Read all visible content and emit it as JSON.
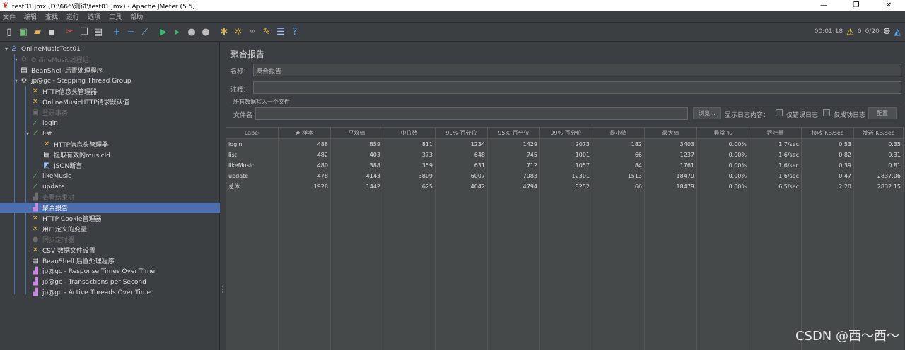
{
  "window": {
    "title": "test01.jmx (D:\\666\\测试\\test01.jmx) - Apache JMeter (5.5)",
    "minimize": "—",
    "maximize": "❐",
    "close": "✕"
  },
  "menu": [
    "文件",
    "编辑",
    "查找",
    "运行",
    "选项",
    "工具",
    "帮助"
  ],
  "status": {
    "elapsed": "00:01:18",
    "warnings": "0",
    "threads": "0/20"
  },
  "tree": [
    {
      "label": "OnlineMusicTest01",
      "icon": "test-plan-icon",
      "level": 0,
      "twisty": "▾",
      "disabled": false
    },
    {
      "label": "OnlineMusic线程组",
      "icon": "gear-icon",
      "level": 1,
      "twisty": "›",
      "disabled": true
    },
    {
      "label": "BeanShell 后置处理程序",
      "icon": "script-icon",
      "level": 1,
      "twisty": "",
      "disabled": false
    },
    {
      "label": "jp@gc - Stepping Thread Group",
      "icon": "gear-icon",
      "level": 1,
      "twisty": "▾",
      "disabled": false
    },
    {
      "label": "HTTP信息头管理器",
      "icon": "wrench-icon",
      "level": 2,
      "twisty": "",
      "disabled": false
    },
    {
      "label": "OnlineMusicHTTP请求默认值",
      "icon": "wrench-icon",
      "level": 2,
      "twisty": "",
      "disabled": false
    },
    {
      "label": "登录事务",
      "icon": "transaction-icon",
      "level": 2,
      "twisty": "",
      "disabled": true
    },
    {
      "label": "login",
      "icon": "pipette-icon",
      "level": 2,
      "twisty": "",
      "disabled": false
    },
    {
      "label": "list",
      "icon": "pipette-icon",
      "level": 2,
      "twisty": "▾",
      "disabled": false
    },
    {
      "label": "HTTP信息头管理器",
      "icon": "wrench-icon",
      "level": 3,
      "twisty": "",
      "disabled": false
    },
    {
      "label": "提取有效的musicId",
      "icon": "script-icon",
      "level": 3,
      "twisty": "",
      "disabled": false
    },
    {
      "label": "JSON断言",
      "icon": "assertion-icon",
      "level": 3,
      "twisty": "",
      "disabled": false
    },
    {
      "label": "likeMusic",
      "icon": "pipette-icon",
      "level": 2,
      "twisty": "",
      "disabled": false
    },
    {
      "label": "update",
      "icon": "pipette-icon",
      "level": 2,
      "twisty": "",
      "disabled": false
    },
    {
      "label": "查看结果树",
      "icon": "chart-icon",
      "level": 2,
      "twisty": "",
      "disabled": true
    },
    {
      "label": "聚合报告",
      "icon": "chart-icon",
      "level": 2,
      "twisty": "",
      "disabled": false,
      "selected": true
    },
    {
      "label": "HTTP Cookie管理器",
      "icon": "wrench-icon",
      "level": 2,
      "twisty": "",
      "disabled": false
    },
    {
      "label": "用户定义的变量",
      "icon": "wrench-icon",
      "level": 2,
      "twisty": "",
      "disabled": false
    },
    {
      "label": "同步定时器",
      "icon": "timer-icon",
      "level": 2,
      "twisty": "",
      "disabled": true
    },
    {
      "label": "CSV 数据文件设置",
      "icon": "wrench-icon",
      "level": 2,
      "twisty": "",
      "disabled": false
    },
    {
      "label": "BeanShell 后置处理程序",
      "icon": "script-icon",
      "level": 2,
      "twisty": "",
      "disabled": false
    },
    {
      "label": "jp@gc - Response Times Over Time",
      "icon": "chart-icon",
      "level": 2,
      "twisty": "",
      "disabled": false
    },
    {
      "label": "jp@gc - Transactions per Second",
      "icon": "chart-icon",
      "level": 2,
      "twisty": "",
      "disabled": false
    },
    {
      "label": "jp@gc - Active Threads Over Time",
      "icon": "chart-icon",
      "level": 2,
      "twisty": "",
      "disabled": false
    }
  ],
  "panel": {
    "title": "聚合报告",
    "name_label": "名称：",
    "name_value": "聚合报告",
    "comment_label": "注释：",
    "comment_value": "",
    "file_section_title": "所有数据写入一个文件",
    "filename_label": "文件名",
    "filename_value": "",
    "browse_button": "浏览...",
    "log_content_label": "显示日志内容：",
    "errors_only_label": "仅错误日志",
    "success_only_label": "仅成功日志",
    "configure_button": "配置"
  },
  "table": {
    "columns": [
      "Label",
      "# 样本",
      "平均值",
      "中位数",
      "90% 百分位",
      "95% 百分位",
      "99% 百分位",
      "最小值",
      "最大值",
      "异常 %",
      "吞吐量",
      "接收 KB/sec",
      "发送 KB/sec"
    ],
    "rows": [
      [
        "login",
        "488",
        "859",
        "811",
        "1234",
        "1429",
        "2073",
        "182",
        "3403",
        "0.00%",
        "1.7/sec",
        "0.53",
        "0.35"
      ],
      [
        "list",
        "482",
        "403",
        "373",
        "648",
        "745",
        "1001",
        "66",
        "1237",
        "0.00%",
        "1.6/sec",
        "0.82",
        "0.31"
      ],
      [
        "likeMusic",
        "480",
        "388",
        "359",
        "631",
        "712",
        "1057",
        "84",
        "1761",
        "0.00%",
        "1.6/sec",
        "0.39",
        "0.81"
      ],
      [
        "update",
        "478",
        "4143",
        "3809",
        "6007",
        "7083",
        "12301",
        "1513",
        "18479",
        "0.00%",
        "1.6/sec",
        "0.47",
        "2837.06"
      ],
      [
        "总体",
        "1928",
        "1442",
        "625",
        "4042",
        "4794",
        "8252",
        "66",
        "18479",
        "0.00%",
        "6.5/sec",
        "2.20",
        "2832.15"
      ]
    ]
  },
  "watermark": "CSDN @西～西～"
}
